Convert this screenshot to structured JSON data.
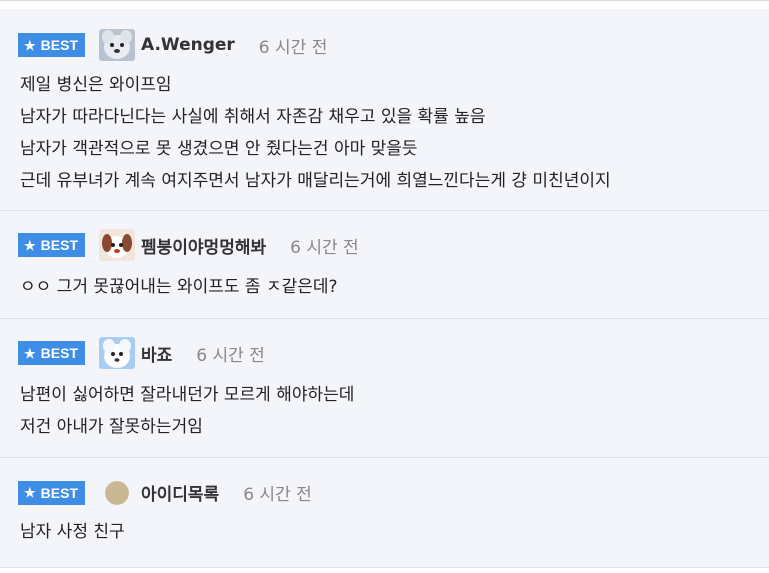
{
  "badge_label": "BEST",
  "colors": {
    "badge": "#3f8ee6",
    "background": "#f3f5fb",
    "time": "#888888"
  },
  "comments": [
    {
      "nick": "A.Wenger",
      "time": "6 시간 전",
      "avatar": "dog-avatar-icon",
      "lines": [
        "제일 병신은 와이프임",
        "남자가 따라다닌다는 사실에 취해서 자존감 채우고 있을 확률 높음",
        "남자가 객관적으로 못 생겼으면 안 줬다는건 아마 맞을듯",
        "근데 유부녀가 계속 여지주면서 남자가 매달리는거에 희열느낀다는게 걍 미친년이지"
      ]
    },
    {
      "nick": "펨붕이야멍멍해봐",
      "time": "6 시간 전",
      "avatar": "puppy-avatar-icon",
      "lines": [
        "ㅇㅇ 그거 못끊어내는 와이프도 좀 ㅈ같은데?"
      ]
    },
    {
      "nick": "바죠",
      "time": "6 시간 전",
      "avatar": "white-dog-avatar-icon",
      "lines": [
        "남편이 싫어하면 잘라내던가 모르게 해야하는데",
        "저건 아내가 잘못하는거임"
      ]
    },
    {
      "nick": "아이디목록",
      "time": "6 시간 전",
      "avatar": "default-circle-avatar-icon",
      "lines": [
        "남자 사정 친구"
      ]
    }
  ]
}
